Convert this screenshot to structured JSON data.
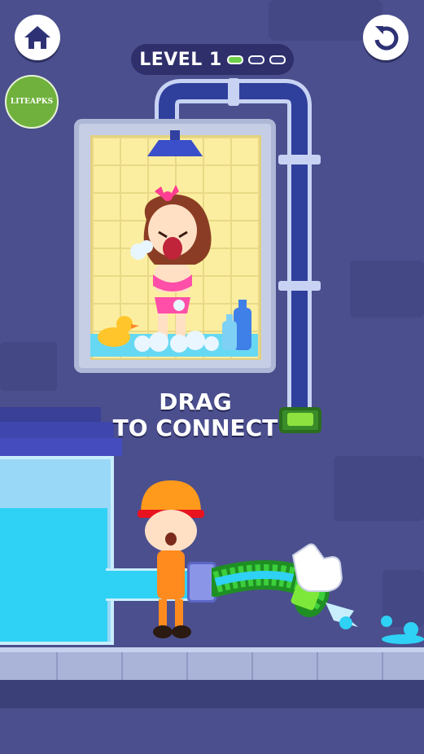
{
  "hud": {
    "home_icon": "home-icon",
    "restart_icon": "restart-icon",
    "level_label": "LEVEL 1",
    "level_progress": {
      "completed": 1,
      "total": 3
    }
  },
  "watermark": {
    "text": "LITEAPKS"
  },
  "hint": {
    "line1": "DRAG",
    "line2": "TO CONNECT"
  },
  "colors": {
    "background": "#4b4f8e",
    "pipe": "#2f3f9c",
    "water": "#2fd1f5",
    "progress_on": "#6ed04a",
    "hose": "#3ccf3c"
  }
}
